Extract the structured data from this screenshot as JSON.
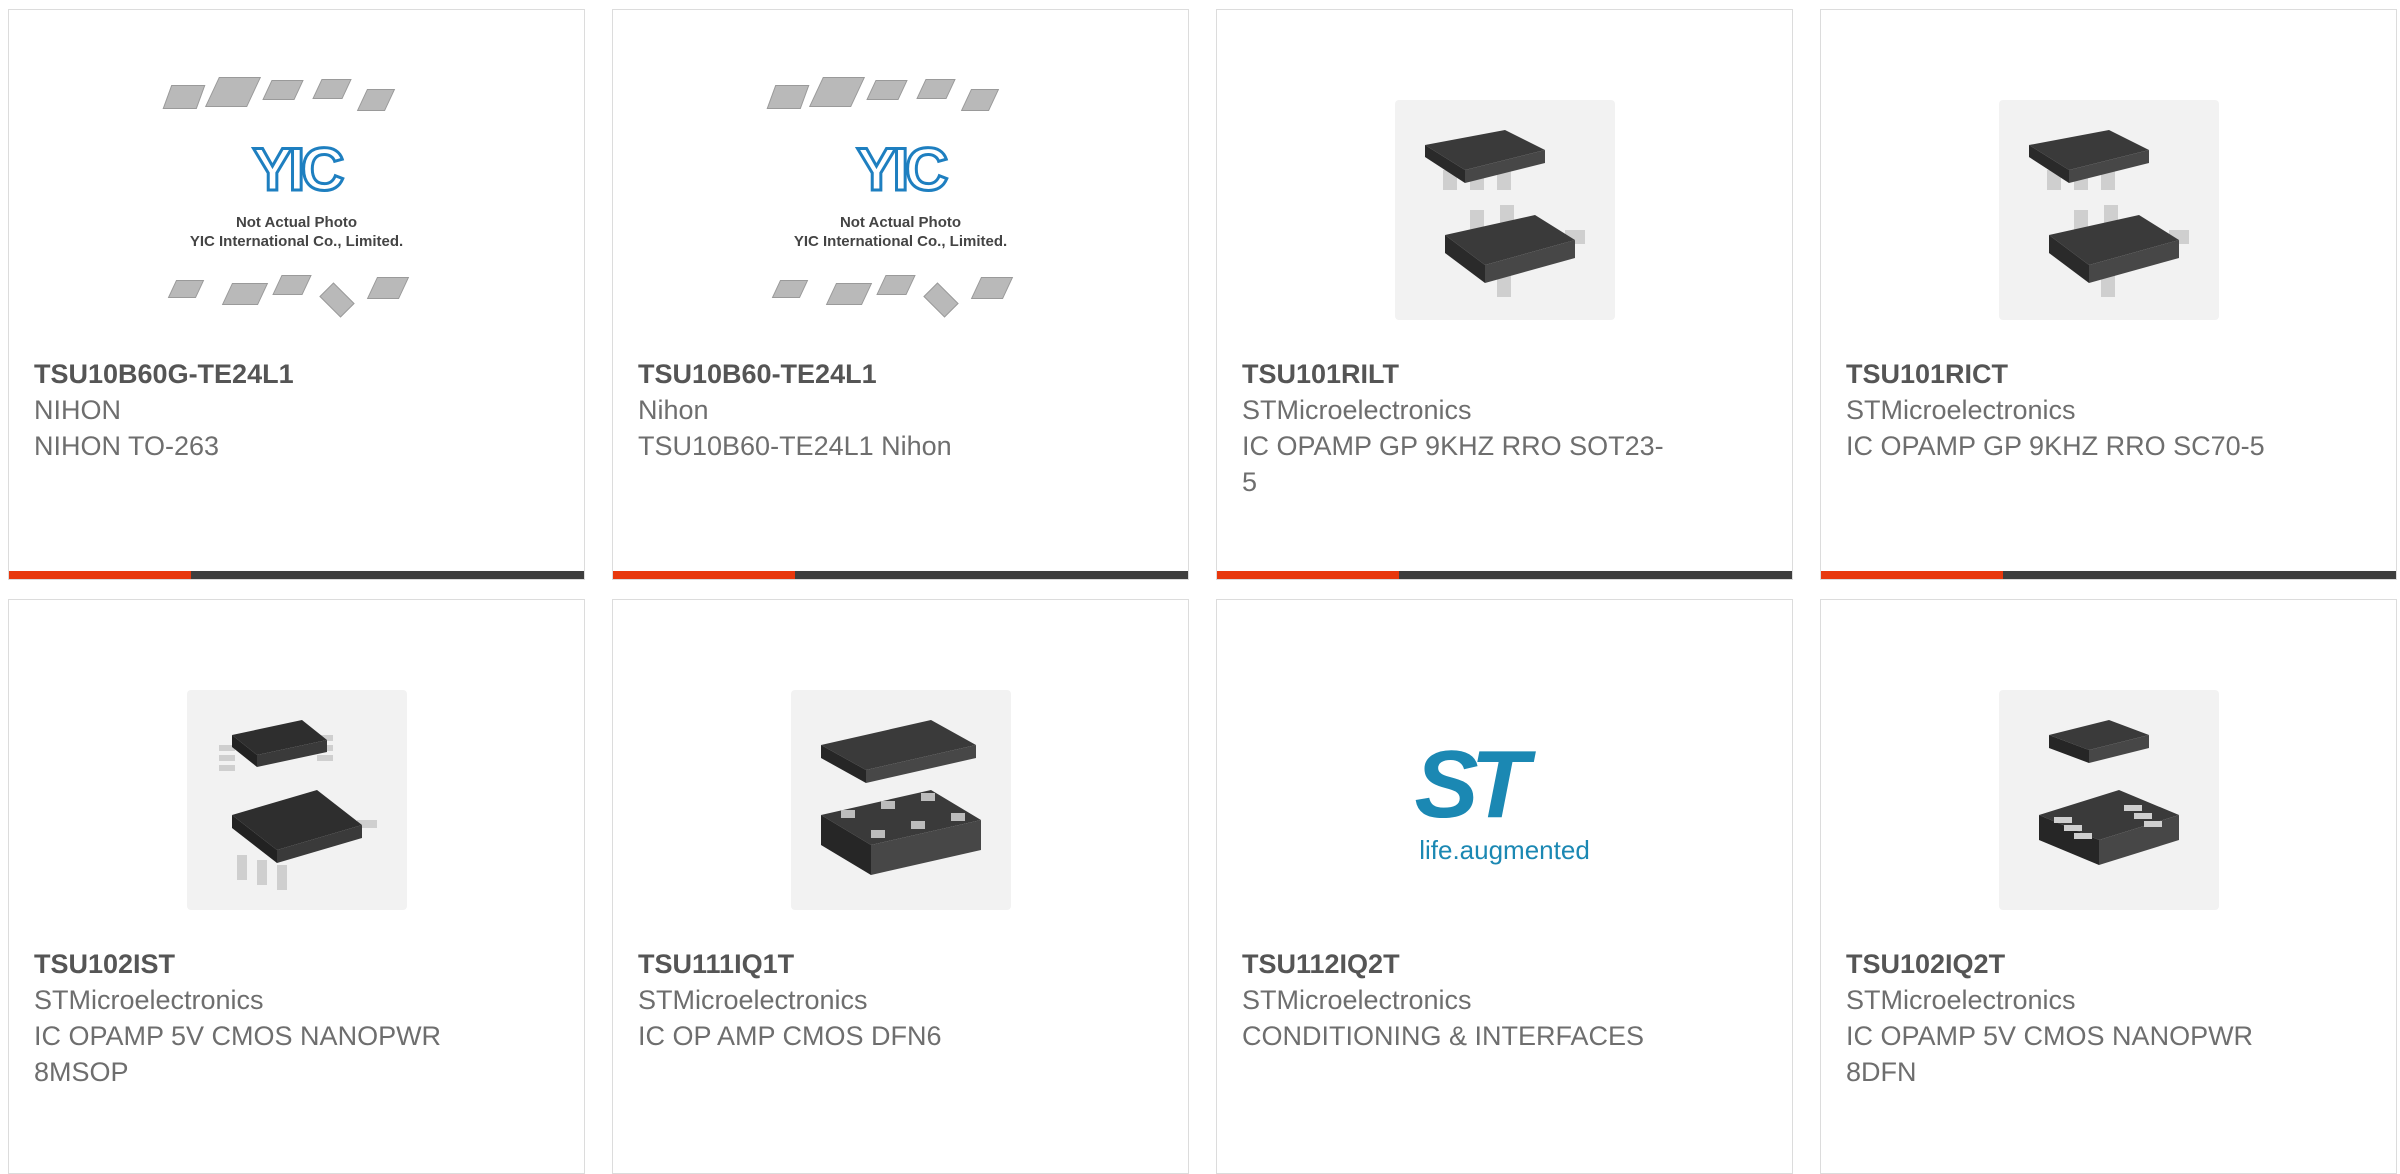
{
  "products": [
    {
      "part": "TSU10B60G-TE24L1",
      "manufacturer": "NIHON",
      "description": "NIHON TO-263",
      "image": "yic-placeholder",
      "image_text": [
        "Not Actual Photo",
        "YIC International Co., Limited."
      ],
      "logo_text": "YIC"
    },
    {
      "part": "TSU10B60-TE24L1",
      "manufacturer": "Nihon",
      "description": "TSU10B60-TE24L1 Nihon",
      "image": "yic-placeholder",
      "image_text": [
        "Not Actual Photo",
        "YIC International Co., Limited."
      ],
      "logo_text": "YIC"
    },
    {
      "part": "TSU101RILT",
      "manufacturer": "STMicroelectronics",
      "description": "IC OPAMP GP 9KHZ RRO SOT23-5",
      "image": "sot23-5-chip"
    },
    {
      "part": "TSU101RICT",
      "manufacturer": "STMicroelectronics",
      "description": "IC OPAMP GP 9KHZ RRO SC70-5",
      "image": "sc70-5-chip"
    },
    {
      "part": "TSU102IST",
      "manufacturer": "STMicroelectronics",
      "description": "IC OPAMP 5V CMOS NANOPWR 8MSOP",
      "image": "msop8-chip"
    },
    {
      "part": "TSU111IQ1T",
      "manufacturer": "STMicroelectronics",
      "description": "IC OP AMP CMOS DFN6",
      "image": "dfn6-chip"
    },
    {
      "part": "TSU112IQ2T",
      "manufacturer": "STMicroelectronics",
      "description": "CONDITIONING & INTERFACES",
      "image": "st-logo",
      "logo_text": "ST",
      "logo_tagline": "life.augmented"
    },
    {
      "part": "TSU102IQ2T",
      "manufacturer": "STMicroelectronics",
      "description": "IC OPAMP 5V CMOS NANOPWR 8DFN",
      "image": "dfn8-chip"
    }
  ],
  "colors": {
    "accent": "#e8380d",
    "bar": "#3e3e3e",
    "st_blue": "#1b88b3",
    "yic_blue": "#1e7fc0"
  }
}
